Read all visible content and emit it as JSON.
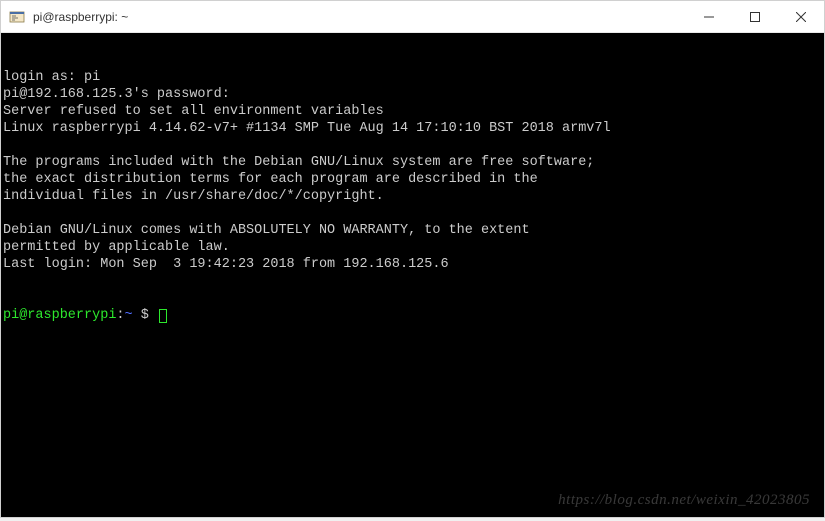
{
  "window": {
    "title": "pi@raspberrypi: ~"
  },
  "terminal": {
    "lines": [
      "login as: pi",
      "pi@192.168.125.3's password:",
      "Server refused to set all environment variables",
      "Linux raspberrypi 4.14.62-v7+ #1134 SMP Tue Aug 14 17:10:10 BST 2018 armv7l",
      "",
      "The programs included with the Debian GNU/Linux system are free software;",
      "the exact distribution terms for each program are described in the",
      "individual files in /usr/share/doc/*/copyright.",
      "",
      "Debian GNU/Linux comes with ABSOLUTELY NO WARRANTY, to the extent",
      "permitted by applicable law.",
      "Last login: Mon Sep  3 19:42:23 2018 from 192.168.125.6"
    ],
    "prompt": {
      "user_host": "pi@raspberrypi",
      "colon": ":",
      "path": "~",
      "symbol": " $ "
    }
  },
  "watermark": "https://blog.csdn.net/weixin_42023805"
}
